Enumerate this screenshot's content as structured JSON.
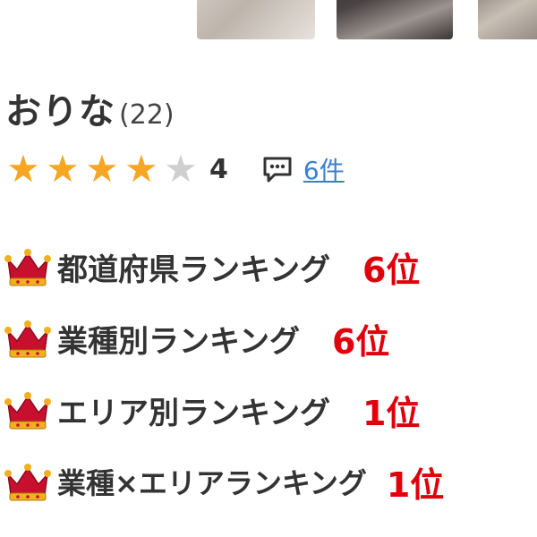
{
  "profile": {
    "name": "おりな",
    "age": "(22)",
    "rating": {
      "value": 4,
      "max": 5,
      "display": "4"
    },
    "reviews": {
      "icon": "comment-icon",
      "count_text": "6件"
    }
  },
  "rankings": [
    {
      "label": "都道府県ランキング",
      "value": "6位",
      "icon": "crown-icon"
    },
    {
      "label": "業種別ランキング",
      "value": "6位",
      "icon": "crown-icon"
    },
    {
      "label": "エリア別ランキング",
      "value": "1位",
      "icon": "crown-icon"
    },
    {
      "label": "業種×エリアランキング",
      "value": "1位",
      "icon": "crown-icon"
    }
  ],
  "colors": {
    "star_on": "#f5a623",
    "star_off": "#cfcfcf",
    "link": "#3b7fd0",
    "rank_value": "#e0000c",
    "crown": "#c8102e",
    "crown_gold": "#f2b01e"
  }
}
